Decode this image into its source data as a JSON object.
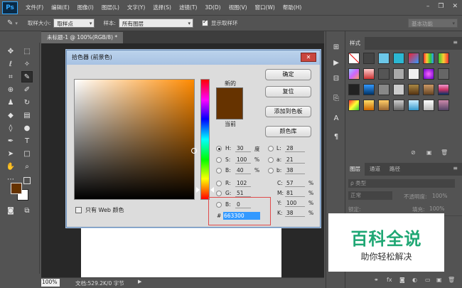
{
  "app": {
    "logo": "Ps"
  },
  "menu": [
    "文件(F)",
    "编辑(E)",
    "图像(I)",
    "图层(L)",
    "文字(Y)",
    "选择(S)",
    "滤镜(T)",
    "3D(D)",
    "视图(V)",
    "窗口(W)",
    "帮助(H)"
  ],
  "options": {
    "sample_size_label": "取样大小:",
    "sample_size_value": "取样点",
    "sample_label": "样本:",
    "sample_value": "所有图层",
    "show_ring_label": "显示取样环",
    "workspace": "基本功能"
  },
  "document": {
    "tab_title": "未标题-1 @ 100%(RGB/8) *"
  },
  "status": {
    "zoom": "100%",
    "doc_info": "文档:529.2K/0 字节"
  },
  "panels": {
    "styles_tab": "样式",
    "layers_tabs": [
      "图层",
      "通道",
      "路径"
    ],
    "filter_kind": "ρ 类型",
    "blend_mode": "正常",
    "opacity_label": "不透明度:",
    "opacity_value": "100%",
    "lock_label": "锁定:",
    "fill_label": "填充:",
    "fill_value": "100%"
  },
  "dialog": {
    "title": "拾色器 (前景色)",
    "new_label": "新的",
    "current_label": "当前",
    "buttons": {
      "ok": "确定",
      "reset": "复位",
      "add_swatch": "添加到色板",
      "color_library": "颜色库"
    },
    "web_only": "只有 Web 颜色",
    "hsb": {
      "h": "30",
      "h_unit": "度",
      "s": "100",
      "s_unit": "%",
      "b": "40",
      "b_unit": "%"
    },
    "rgb": {
      "r": "102",
      "g": "51",
      "b": "0"
    },
    "lab": {
      "l": "28",
      "a": "21",
      "b": "38"
    },
    "cmyk": {
      "c": "57",
      "m": "81",
      "y": "100",
      "k": "38",
      "unit": "%"
    },
    "hex_label": "#",
    "hex": "663300",
    "new_color": "#663300"
  },
  "watermark": {
    "title": "百科全说",
    "subtitle": "助你轻松解决"
  },
  "colors": {
    "foreground": "#663300",
    "background": "#ffffff",
    "accent": "#1fa774"
  }
}
